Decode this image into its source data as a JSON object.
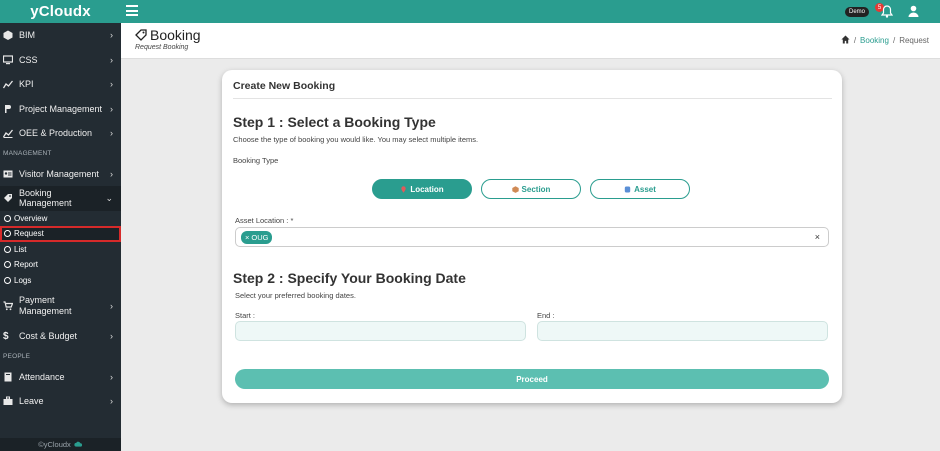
{
  "app": {
    "brand": "yCloudx",
    "footer": "©yCloudx"
  },
  "sidebar": {
    "items_top": [
      {
        "label": "BIM"
      },
      {
        "label": "CSS"
      },
      {
        "label": "KPI"
      },
      {
        "label": "Project Management"
      },
      {
        "label": "OEE & Production"
      }
    ],
    "section_management": "MANAGEMENT",
    "visitor": {
      "label": "Visitor Management"
    },
    "booking": {
      "label": "Booking Management",
      "children": [
        "Overview",
        "Request",
        "List",
        "Report",
        "Logs"
      ]
    },
    "payment": {
      "label_line1": "Payment",
      "label_line2": "Management"
    },
    "cost": {
      "label": "Cost & Budget"
    },
    "section_people": "PEOPLE",
    "attendance": {
      "label": "Attendance"
    },
    "leave": {
      "label": "Leave"
    }
  },
  "topbar": {
    "demo_badge": "Demo",
    "notification_count": "5"
  },
  "header": {
    "title": "Booking",
    "subtitle": "Request Booking",
    "breadcrumb": {
      "link": "Booking",
      "sep": "/",
      "current": "Request"
    }
  },
  "card": {
    "title": "Create New Booking",
    "step1": {
      "title": "Step 1 : Select a Booking Type",
      "desc": "Choose the type of booking you would like. You may select multiple items.",
      "field_label": "Booking Type",
      "options": [
        {
          "label": "Location",
          "selected": true
        },
        {
          "label": "Section",
          "selected": false
        },
        {
          "label": "Asset",
          "selected": false
        }
      ],
      "asset_location_label": "Asset Location : *",
      "selected_chip": "OUG",
      "clear_symbol": "×",
      "chip_remove_symbol": "×"
    },
    "step2": {
      "title": "Step 2 : Specify Your Booking Date",
      "desc": "Select your preferred booking dates.",
      "start_label": "Start :",
      "end_label": "End :",
      "start_value": "",
      "end_value": ""
    },
    "proceed_label": "Proceed"
  },
  "colors": {
    "accent": "#2a9d8f",
    "sidebar_bg": "#232c33",
    "highlight": "#d62a2a"
  }
}
